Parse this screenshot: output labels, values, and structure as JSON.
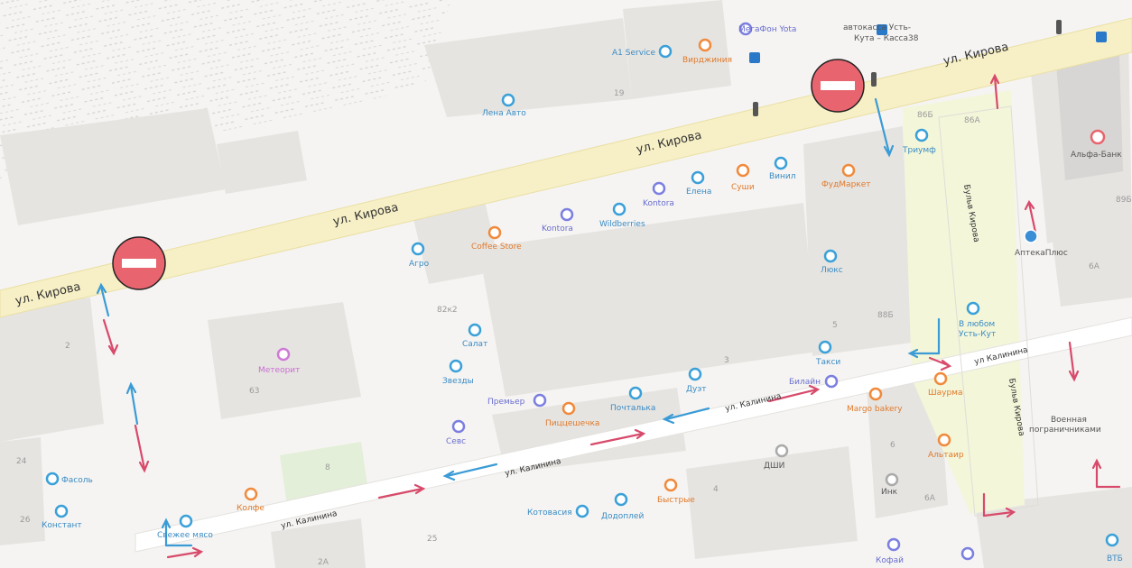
{
  "streets": {
    "kirova_1": "ул. Кирова",
    "kirova_2": "ул. Кирова",
    "kirova_3": "ул. Кирова",
    "kirova_4": "ул. Кирова",
    "kalinina_1": "ул. Калинина",
    "kalinina_2": "ул. Калинина",
    "kalinina_3": "ул. Калинина",
    "kalinina_4": "ул Калинина",
    "bulvar_1": "Бульв Кирова",
    "bulvar_2": "Бульв Кирова"
  },
  "buildings": {
    "b19": "19",
    "b82x2": "82к2",
    "b63": "63",
    "b5": "5",
    "b3": "3",
    "b4": "4",
    "b6": "6",
    "b6a": "6А",
    "b86": "86Б",
    "b86b": "86А",
    "b88": "88Б",
    "b2": "2",
    "b24": "24",
    "b26": "26",
    "b25": "25",
    "b2a": "2А",
    "b8": "8",
    "b89": "89Б",
    "bA": "6А"
  },
  "pois": {
    "a1service": "A1 Service",
    "megafon": "МегаФон Yota",
    "virginia": "Вирджиния",
    "avtokassa_1": "автокасса Усть-",
    "avtokassa_2": "Кута – Касса38",
    "lena_avto": "Лена Авто",
    "triumf": "Триумф",
    "alfa_bank": "Альфа-Банк",
    "vinyl": "Винил",
    "elena": "Елена",
    "sushi": "Суши",
    "furniture": "ФудМаркет",
    "kontora": "Kontora",
    "wildberries": "Wildberries",
    "coffee_store": "Coffee Store",
    "agro": "Агро",
    "lux": "Люкс",
    "apteka_plus": "АптекаПлюс",
    "vlyubom_1": "В любом",
    "vlyubom_2": "Усть-Кут",
    "salat": "Салат",
    "zvezdy": "Звезды",
    "meteorit": "Метеорит",
    "taxi": "Такси",
    "bilain": "Билайн",
    "margo": "Margo bakery",
    "shaurma": "Шаурма",
    "premier": "Премьер",
    "pochtalka": "Почталька",
    "duet": "Дуэт",
    "pizzeria": "Пиццешечка",
    "sevs": "Севс",
    "dshi": "ДШИ",
    "voennaya_1": "Военная",
    "voennaya_2": "пограничниками",
    "altair": "Альтаир",
    "ink": "Инк",
    "fasol": "Фасоль",
    "konstanta": "Констант",
    "kolfe": "Колфе",
    "bystrye": "Быстрые",
    "kotovasiya": "Котовасия",
    "dodoplei": "Додоплей",
    "kofai": "Кофай",
    "vtb": "ВТБ",
    "sanek": "Свежее мясо"
  },
  "colors": {
    "no_entry": "#e8646e",
    "red_arrow": "#d84a6b",
    "blue_arrow": "#3a9bd6",
    "poi_blue": "#3aa0d8",
    "poi_orange": "#f08a3c",
    "poi_purple": "#7b7fe0",
    "road_yellow": "#f7f0c6"
  },
  "icons": {
    "no_entry": "no-entry-sign-icon",
    "traffic_light": "traffic-light-icon",
    "bus_stop": "bus-stop-icon"
  }
}
